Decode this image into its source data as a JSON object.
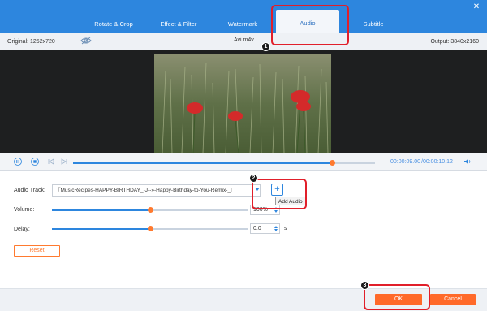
{
  "tabs": [
    {
      "label": "Rotate & Crop"
    },
    {
      "label": "Effect & Filter"
    },
    {
      "label": "Watermark"
    },
    {
      "label": "Audio"
    },
    {
      "label": "Subtitle"
    }
  ],
  "window": {
    "close_icon": "close-icon",
    "restore_icon": "restore-icon"
  },
  "info": {
    "original": "Original: 1252x720",
    "filename": "Avi.m4v",
    "output": "Output: 3840x2160"
  },
  "playback": {
    "current_time": "00:00:09.00",
    "total_time": "/00:00:10.12",
    "progress": 0.86
  },
  "audio": {
    "track_label": "Audio Track:",
    "track_value": "『MusicRecipes-HAPPY-BIRTHDAY_-J--»-Happy-Birthday-to-You-Remix-_I",
    "add_tooltip": "Add Audio",
    "volume_label": "Volume:",
    "volume_value": "100%",
    "volume_level": 0.5,
    "delay_label": "Delay:",
    "delay_value": "0.0",
    "delay_unit": "s",
    "delay_level": 0.5
  },
  "buttons": {
    "reset": "Reset",
    "ok": "OK",
    "cancel": "Cancel"
  },
  "annotations": [
    "1",
    "2",
    "3"
  ],
  "colors": {
    "accent": "#2d86de",
    "orange": "#ff6a2a",
    "highlight": "#e11f2a"
  }
}
